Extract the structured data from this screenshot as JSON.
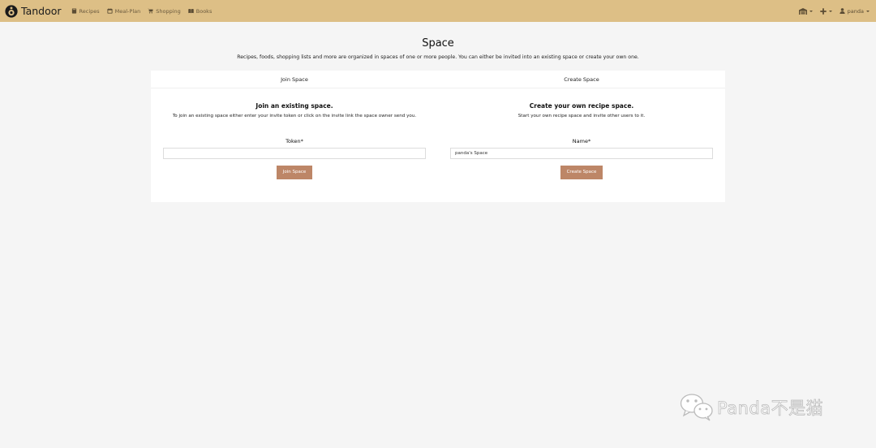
{
  "navbar": {
    "brand": "Tandoor",
    "links": [
      {
        "label": "Recipes",
        "icon": "book-icon"
      },
      {
        "label": "Meal-Plan",
        "icon": "calendar-icon"
      },
      {
        "label": "Shopping",
        "icon": "cart-icon"
      },
      {
        "label": "Books",
        "icon": "open-book-icon"
      }
    ],
    "user": "panda",
    "bg_color": "#ddbf86"
  },
  "header": {
    "title": "Space",
    "subtitle": "Recipes, foods, shopping lists and more are organized in spaces of one or more people. You can either be invited into an existing space or create your own one."
  },
  "tabs": [
    {
      "label": "Join Space"
    },
    {
      "label": "Create Space"
    }
  ],
  "join": {
    "title": "Join an existing space.",
    "description": "To join an existing space either enter your invite token or click on the invite link the space owner send you.",
    "field_label": "Token*",
    "field_value": "",
    "button_label": "Join Space"
  },
  "create": {
    "title": "Create your own recipe space.",
    "description": "Start your own recipe space and invite other users to it.",
    "field_label": "Name*",
    "field_value": "panda's Space",
    "button_label": "Create Space"
  },
  "watermark": {
    "text": "Panda不是猫"
  },
  "colors": {
    "accent": "#bd8667",
    "background": "#f5f5f5"
  }
}
